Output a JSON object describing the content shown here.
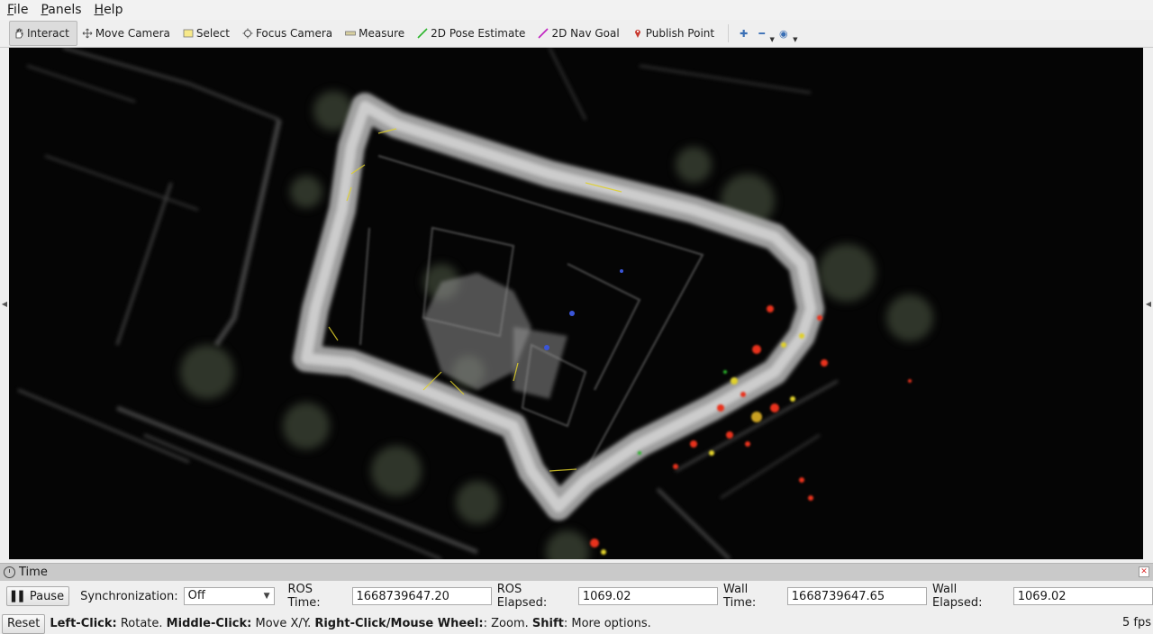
{
  "menu": [
    {
      "accel": "F",
      "rest": "ile"
    },
    {
      "accel": "P",
      "rest": "anels"
    },
    {
      "accel": "H",
      "rest": "elp"
    }
  ],
  "tools": [
    {
      "label": "Interact",
      "icon": "hand-icon",
      "active": true
    },
    {
      "label": "Move Camera",
      "icon": "move-camera-icon",
      "active": false
    },
    {
      "label": "Select",
      "icon": "select-icon",
      "active": false
    },
    {
      "label": "Focus Camera",
      "icon": "focus-camera-icon",
      "active": false
    },
    {
      "label": "Measure",
      "icon": "measure-icon",
      "active": false
    },
    {
      "label": "2D Pose Estimate",
      "icon": "pose-estimate-icon",
      "active": false
    },
    {
      "label": "2D Nav Goal",
      "icon": "nav-goal-icon",
      "active": false
    },
    {
      "label": "Publish Point",
      "icon": "publish-point-icon",
      "active": false
    }
  ],
  "time_panel": {
    "title": "Time",
    "pause_label": "Pause",
    "sync_label": "Synchronization:",
    "sync_value": "Off",
    "ros_time_label": "ROS Time:",
    "ros_time": "1668739647.20",
    "ros_elapsed_label": "ROS Elapsed:",
    "ros_elapsed": "1069.02",
    "wall_time_label": "Wall Time:",
    "wall_time": "1668739647.65",
    "wall_elapsed_label": "Wall Elapsed:",
    "wall_elapsed": "1069.02"
  },
  "status": {
    "reset_label": "Reset",
    "hint_1_key": "Left-Click:",
    "hint_1_text": " Rotate. ",
    "hint_2_key": "Middle-Click:",
    "hint_2_text": " Move X/Y. ",
    "hint_3_key": "Right-Click/Mouse Wheel:",
    "hint_3_text": ": Zoom. ",
    "hint_4_key": "Shift",
    "hint_4_text": ": More options.",
    "fps": "5 fps"
  },
  "colors": {
    "viewport_bg": "#050505",
    "cloud_gray": "#a9a9a9",
    "highlight_red": "#e8301c",
    "highlight_yellow": "#e0d02a",
    "pose_green": "#2bb52b",
    "nav_magenta": "#c021c0"
  }
}
